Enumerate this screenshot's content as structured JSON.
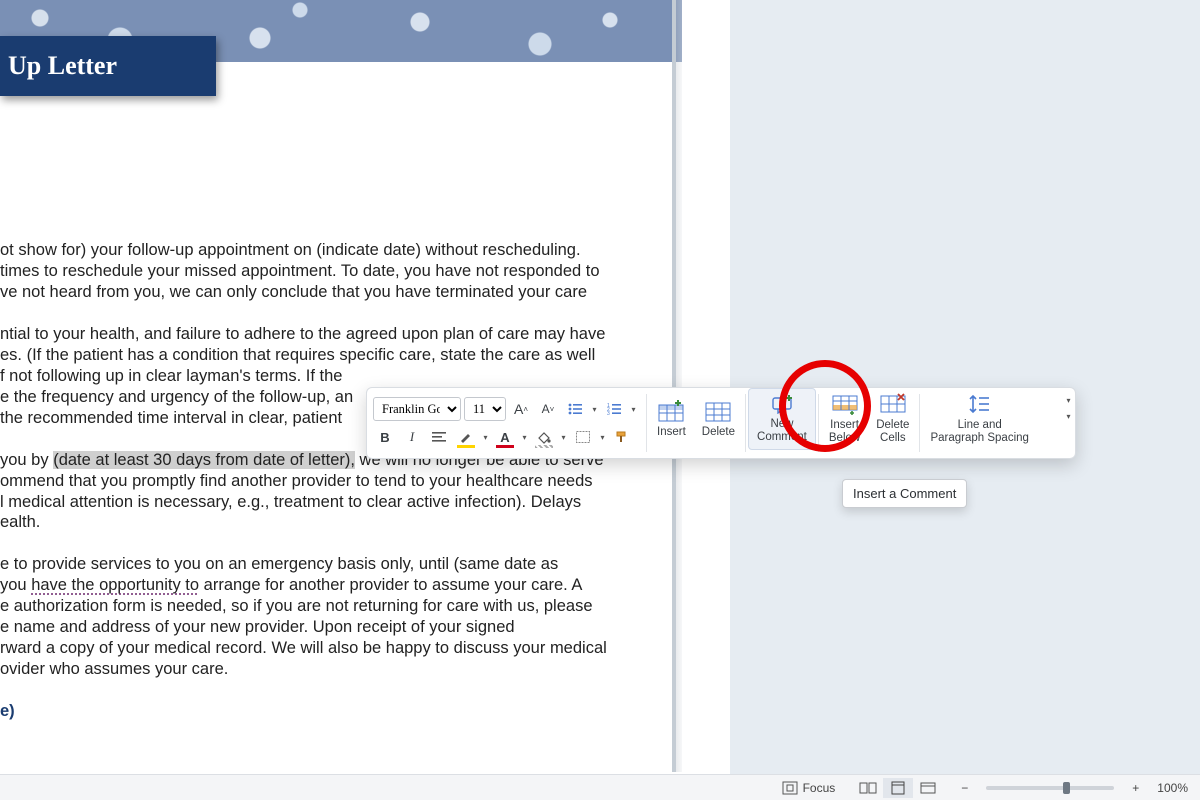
{
  "header": {
    "title": "Up Letter"
  },
  "doc": {
    "p1": "ot show for) your follow-up appointment on (indicate date) without rescheduling.\ntimes to reschedule your missed appointment. To date, you have not responded to\nve not heard from you, we can only conclude that you have terminated your care",
    "p2": "ntial to your health, and failure to adhere to the agreed upon plan of care may have\nes. (If the patient has a condition that requires specific care, state the care as well\nf not following up in clear layman's terms. If the\ne the frequency and urgency of the follow-up, an\nthe recommended time interval in clear, patient",
    "p3_pre": "you by ",
    "p3_hl": "(date at least 30 days from date of letter),",
    "p3_post": " we will no longer be able to serve\nommend that you promptly find another provider to tend to your healthcare needs\nl medical attention is necessary, e.g., treatment to clear active infection). Delays\nealth.",
    "p4_a": "e to provide services to you on an emergency basis only, until (same date as\nyou ",
    "p4_wavy": "have the opportunity to",
    "p4_b": " arrange for another provider to assume your care. A\ne authorization form is needed, so if you are not returning for care with us, please\ne name and address of your new provider. Upon receipt of your signed\nrward a copy of your medical record. We will also be happy to discuss your medical\novider who assumes your care.",
    "link": "e)"
  },
  "mini": {
    "font": "Franklin Got",
    "size": "11",
    "buttons": {
      "growFont": "A˄",
      "shrinkFont": "A˅",
      "bold": "B",
      "italic": "I",
      "formatPainter": "✎"
    },
    "labels": {
      "insert": "Insert",
      "delete": "Delete",
      "newComment1": "New",
      "newComment2": "Comment",
      "insertBelow1": "Insert",
      "insertBelow2": "Below",
      "deleteCells1": "Delete",
      "deleteCells2": "Cells",
      "spacing1": "Line and",
      "spacing2": "Paragraph Spacing"
    }
  },
  "tooltip": "Insert a Comment",
  "status": {
    "focus": "Focus",
    "zoom": "100%"
  }
}
